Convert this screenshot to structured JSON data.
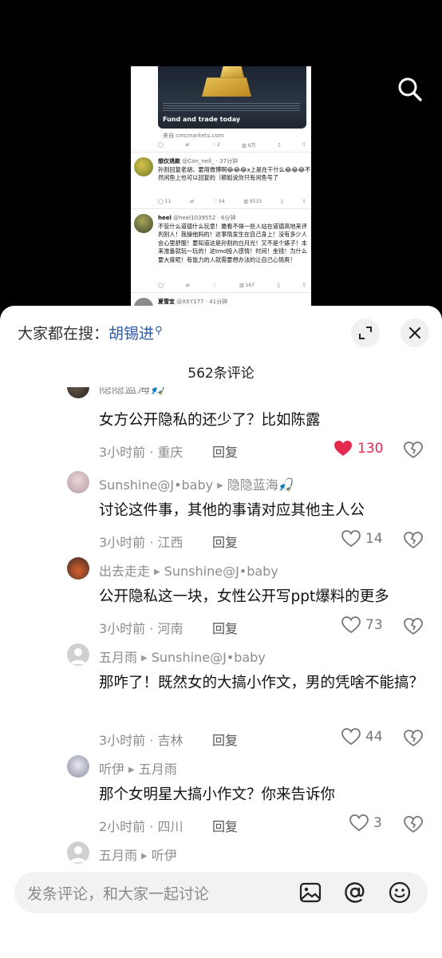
{
  "embedded_post": {
    "ad_cta": "Fund and trade today",
    "ad_source": "来自 cmcmarkets.com",
    "ad_actions": [
      "",
      "",
      "2",
      "6万",
      "",
      ""
    ],
    "posts": [
      {
        "name": "想仅退款",
        "handle": "@Con_nell_",
        "time": "37分钟",
        "text": "孙割回复老胡，要用微博啊😂😂😂x上是在干什么😂😂😂不然闲鱼上也可以回复的（赖姐说你只有闲鱼号了",
        "actions": [
          "11",
          "",
          "54",
          "9515",
          "",
          ""
        ]
      },
      {
        "name": "heel",
        "handle": "@heel1039552",
        "time": "6分钟",
        "text": "不管什么道德什么玩意！最看不得一些人站在道德高地来评判别人！我操他妈的！这事情发生在自己身上！没有多少人会心里舒服！要知道这是孙割的白月光！又不是个婊子！本来准备就玩一玩的！这tmd投入感情！时间！金钱！为什么要大度呢！有能力的人就需要想办法的让自己心情爽！",
        "actions": [
          "",
          "",
          "",
          "167",
          "",
          ""
        ]
      },
      {
        "name": "夏雪宜",
        "handle": "@XXY177",
        "time": "41分钟",
        "text": "",
        "actions": []
      }
    ]
  },
  "sheet": {
    "search_prefix": "大家都在搜：",
    "search_term": "胡锡进",
    "comment_count": "562条评论",
    "reply_label": "回复",
    "comments": [
      {
        "user": "隐隐蓝海🎣",
        "reply_to": "",
        "text": "女方公开隐私的还少了？比如陈露",
        "time_loc": "3小时前 · 重庆",
        "likes": "130",
        "liked": true
      },
      {
        "user": "Sunshine@J•baby",
        "reply_to": "隐隐蓝海🎣",
        "text": "讨论这件事，其他的事请对应其他主人公",
        "time_loc": "3小时前 · 江西",
        "likes": "14",
        "liked": false
      },
      {
        "user": "出去走走",
        "reply_to": "Sunshine@J•baby",
        "text": "公开隐私这一块，女性公开写ppt爆料的更多",
        "time_loc": "3小时前 · 河南",
        "likes": "73",
        "liked": false
      },
      {
        "user": "五月雨",
        "reply_to": "Sunshine@J•baby",
        "text": "那咋了！既然女的大搞小作文，男的凭啥不能搞？",
        "time_loc": "3小时前 · 吉林",
        "likes": "44",
        "liked": false
      },
      {
        "user": "听伊",
        "reply_to": "五月雨",
        "text": "那个女明星大搞小作文？你来告诉你",
        "time_loc": "2小时前 · 四川",
        "likes": "3",
        "liked": false
      },
      {
        "user": "五月雨",
        "reply_to": "听伊",
        "text": "",
        "time_loc": "",
        "likes": "",
        "liked": false
      }
    ],
    "input_placeholder": "发条评论，和大家一起讨论"
  },
  "colors": {
    "like_active": "#e6294f",
    "search_term": "#2a5aa8"
  },
  "icons": [
    "search-icon",
    "expand-icon",
    "close-icon",
    "heart-icon",
    "dislike-heart-icon",
    "image-icon",
    "at-icon",
    "emoji-icon"
  ]
}
